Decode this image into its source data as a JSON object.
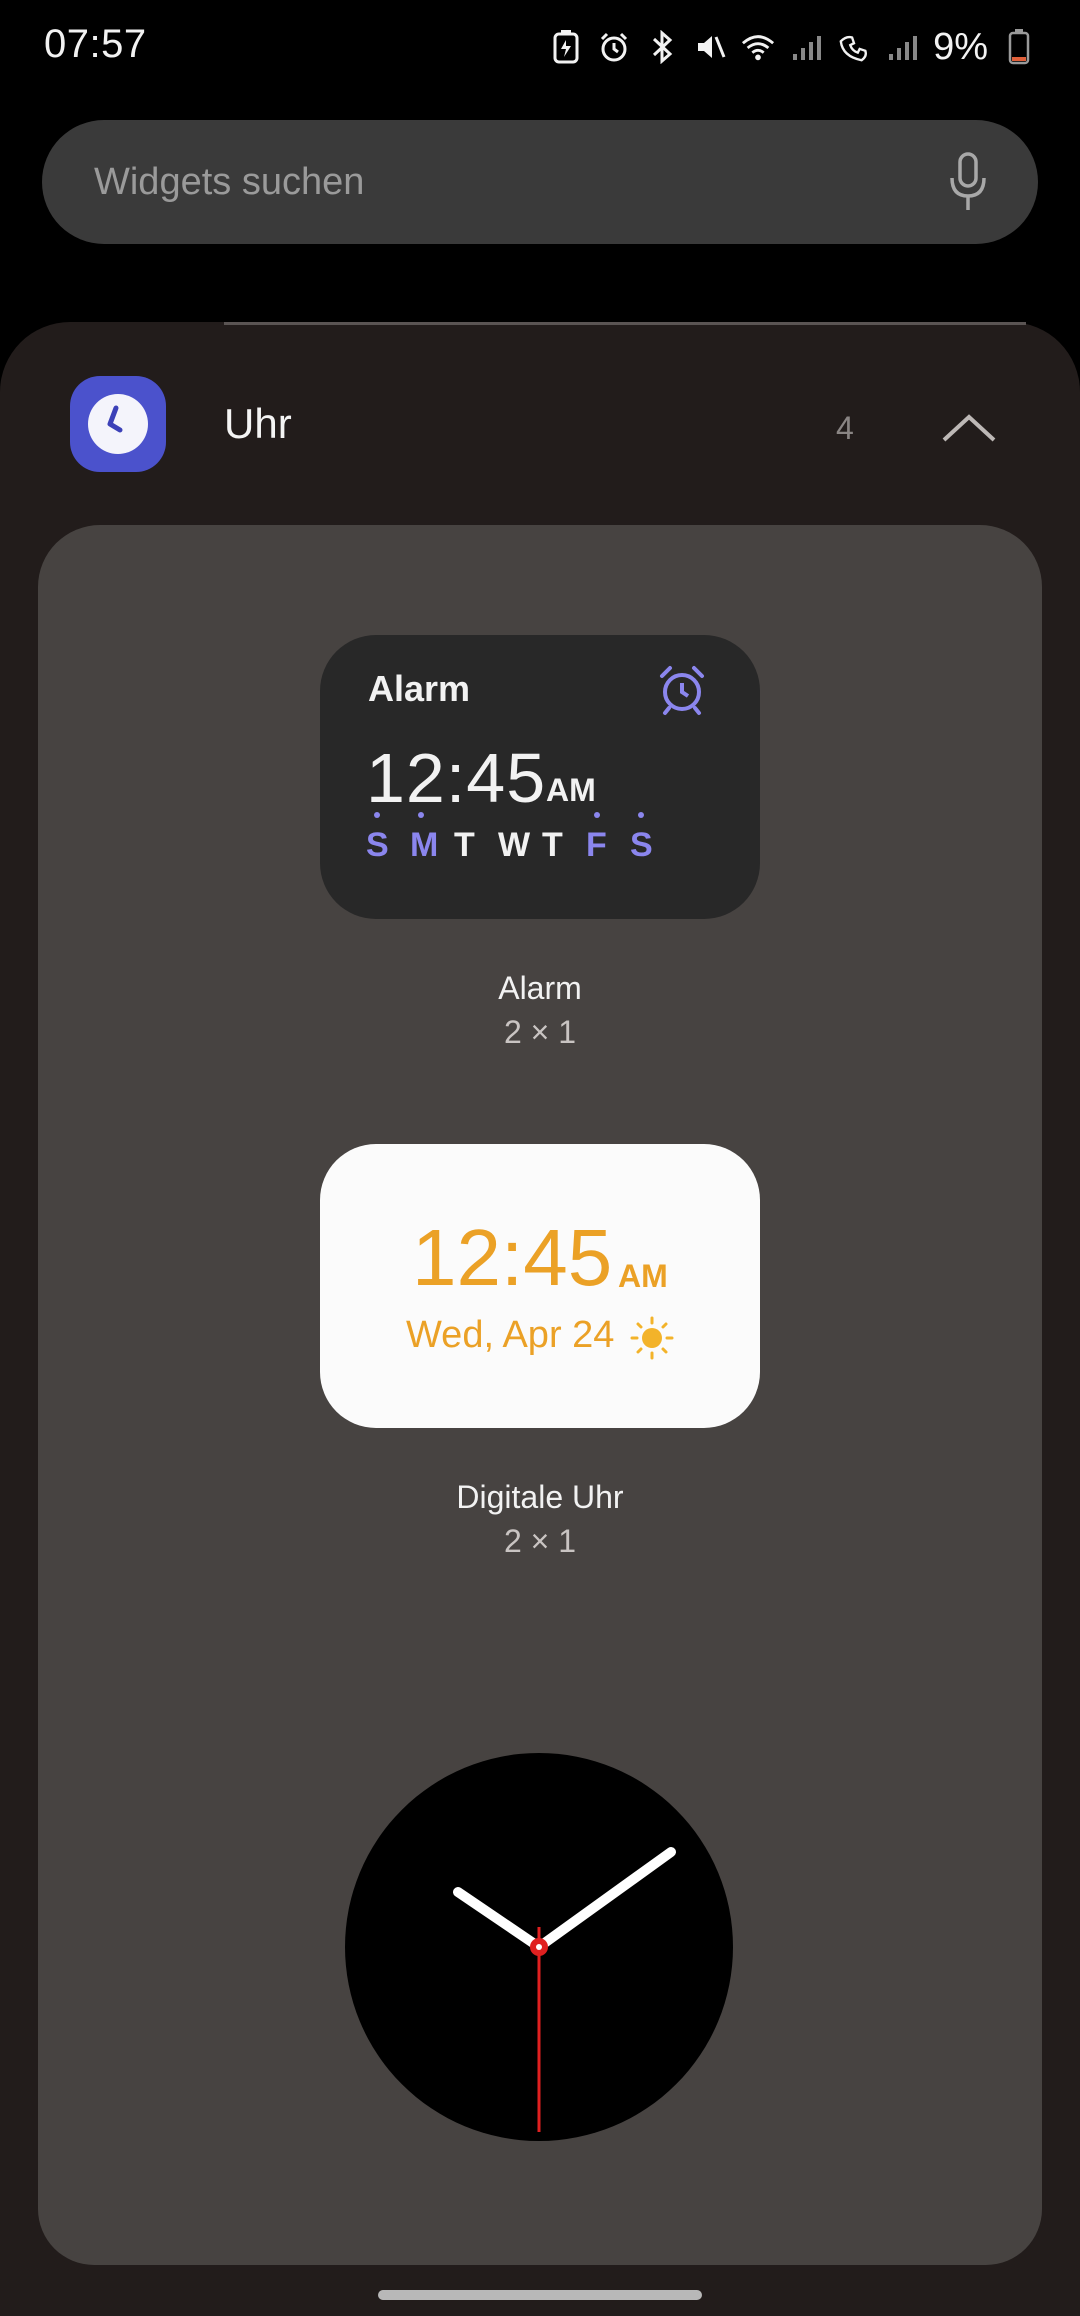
{
  "status_bar": {
    "time": "07:57",
    "battery_percent": "9%",
    "icons": [
      "battery-saver-icon",
      "alarm-icon",
      "bluetooth-icon",
      "mute-icon",
      "wifi-icon",
      "signal-icon",
      "wifi-calling-icon",
      "signal-icon"
    ]
  },
  "search": {
    "placeholder": "Widgets suchen",
    "mic_icon": "microphone-icon"
  },
  "app_group": {
    "name": "Uhr",
    "count": "4",
    "expanded": true,
    "accent": "#4b52cc"
  },
  "widgets": [
    {
      "label": "Alarm",
      "size": "2 × 1",
      "preview": {
        "title": "Alarm",
        "time": "12:45",
        "ampm": "AM",
        "days": [
          {
            "d": "S",
            "on": true
          },
          {
            "d": "M",
            "on": true
          },
          {
            "d": "T",
            "on": false
          },
          {
            "d": "W",
            "on": false
          },
          {
            "d": "T",
            "on": false
          },
          {
            "d": "F",
            "on": true
          },
          {
            "d": "S",
            "on": true
          }
        ]
      }
    },
    {
      "label": "Digitale Uhr",
      "size": "2 × 1",
      "preview": {
        "time": "12:45",
        "ampm": "AM",
        "date": "Wed, Apr 24",
        "color": "#eba126"
      }
    },
    {
      "label": "",
      "size": "",
      "preview": {
        "type": "analog-clock"
      }
    }
  ]
}
